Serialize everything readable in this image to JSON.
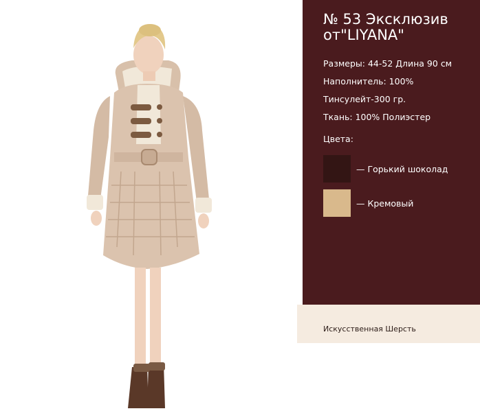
{
  "product": {
    "title": "№ 53 Эксклюзив от\"LIYANA\"",
    "specs": [
      "Размеры: 44-52 Длина 90 см",
      "Наполнитель: 100% Тинсулейт-300 гр.",
      "Ткань: 100% Полиэстер"
    ],
    "colors_label": "Цвета:",
    "colors": [
      {
        "name": "— Горький шоколад",
        "hex": "#331514"
      },
      {
        "name": "— Кремовый",
        "hex": "#d9b98c"
      }
    ],
    "material": "Искусственная Шерсть"
  },
  "theme": {
    "panel_bg": "#4a1b1e",
    "material_bg": "#f5ebe0",
    "coat_color": "#dbc3ae"
  }
}
